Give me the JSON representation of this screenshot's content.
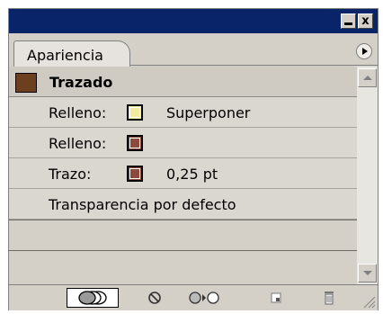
{
  "window": {
    "minimize_icon": "minimize-icon",
    "close_label": "x"
  },
  "tabs": [
    {
      "label": "Apariencia"
    }
  ],
  "panel_menu_icon": "panel-menu-icon",
  "header_row": {
    "label": "Trazado",
    "swatch_color": "#6b3f1f"
  },
  "rows": [
    {
      "label": "Relleno:",
      "swatch_color": "#f2eba0",
      "value": "Superponer"
    },
    {
      "label": "Relleno:",
      "swatch_color": "#8b4a3c",
      "value": ""
    },
    {
      "label": "Trazo:",
      "swatch_color": "#8b4a3c",
      "value": "0,25 pt"
    },
    {
      "label": "Transparencia por defecto",
      "swatch_color": "",
      "value": ""
    }
  ],
  "toolbar": {
    "items": [
      {
        "icon": "new-art-maintains-appearance-icon",
        "active": true
      },
      {
        "icon": "clear-appearance-icon",
        "active": false
      },
      {
        "icon": "reduce-to-basic-appearance-icon",
        "active": false
      },
      {
        "icon": "duplicate-item-icon",
        "active": false
      },
      {
        "icon": "trash-icon",
        "active": false
      }
    ]
  },
  "colors": {
    "title_bar": "#0a246a",
    "panel_bg": "#d4d0c8"
  }
}
